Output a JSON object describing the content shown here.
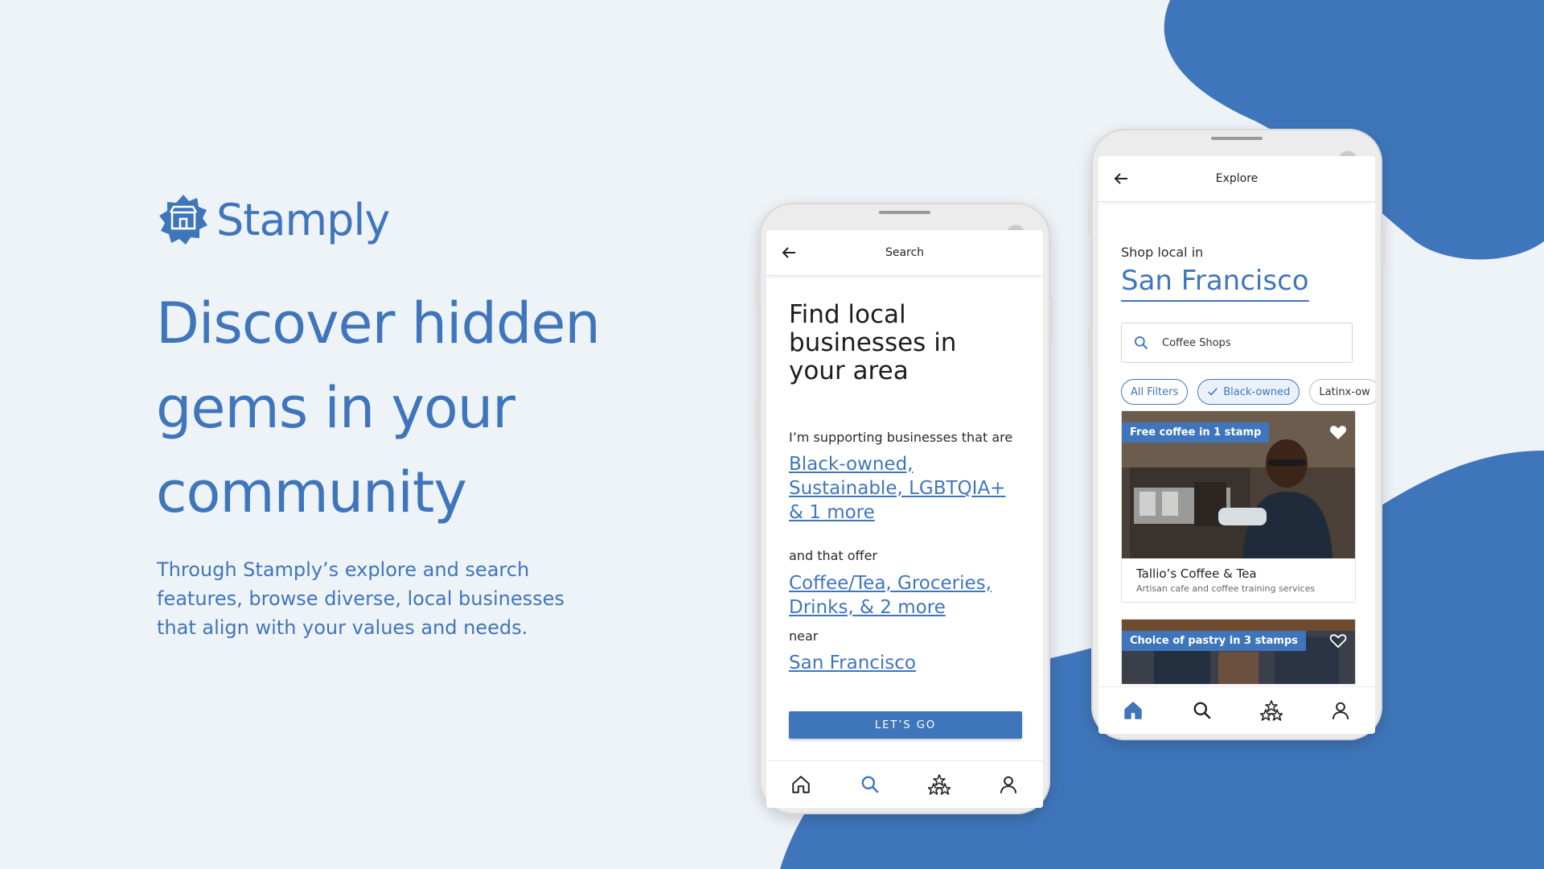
{
  "colors": {
    "brand": "#3f76bb",
    "background": "#eef3f8",
    "blob": "#3f76bb"
  },
  "brand": {
    "name": "Stamply",
    "logo_icon": "storefront-badge-icon"
  },
  "headline": "Discover hidden gems in your community",
  "subcopy": "Through Stamply’s explore and search features, browse diverse, local businesses that align with your values and needs.",
  "search_screen": {
    "title": "Search",
    "heading": "Find local businesses in your area",
    "supporting_label": "I’m supporting businesses that are",
    "values_link": "Black-owned, Sustainable, LGBTQIA+ & 1 more",
    "offer_label": "and that offer",
    "offer_link": "Coffee/Tea, Groceries, Drinks, & 2 more",
    "near_label": "near",
    "location_link": "San Francisco",
    "cta": "LET’S GO",
    "active_tab": "search"
  },
  "explore_screen": {
    "title": "Explore",
    "shop_local_label": "Shop local in",
    "city": "San Francisco",
    "search_value": "Coffee Shops",
    "chips": [
      {
        "label": "All Filters"
      },
      {
        "label": "Black-owned",
        "selected": true
      },
      {
        "label": "Latinx-ow"
      }
    ],
    "cards": [
      {
        "badge": "Free coffee in 1 stamp",
        "name": "Tallio’s Coffee & Tea",
        "description": "Artisan cafe and coffee training services"
      },
      {
        "badge": "Choice of pastry in 3 stamps"
      }
    ],
    "active_tab": "home"
  },
  "bottom_nav": [
    "home-icon",
    "search-icon",
    "stamps-icon",
    "profile-icon"
  ]
}
